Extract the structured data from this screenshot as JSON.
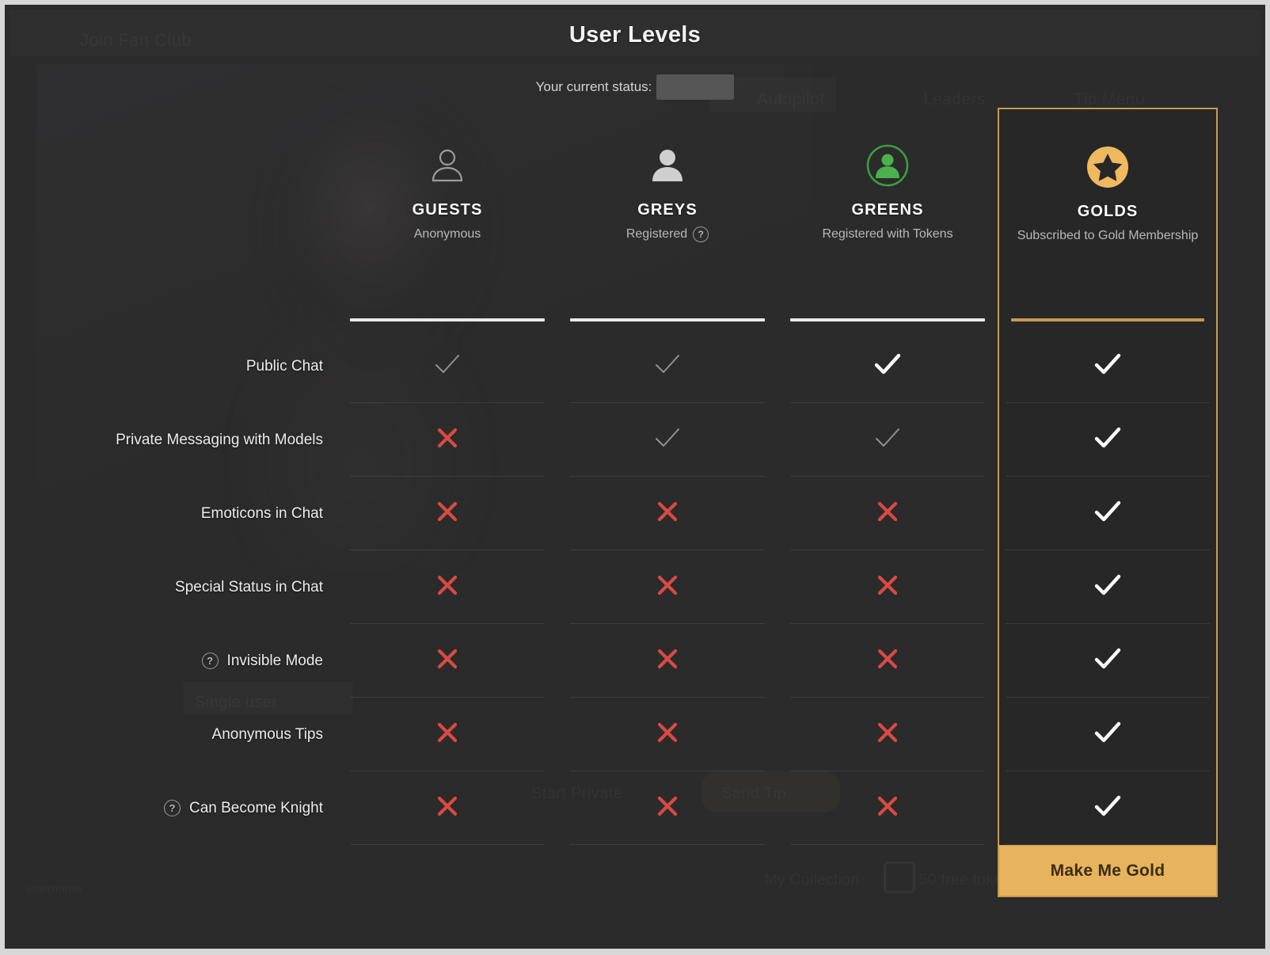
{
  "modal": {
    "title": "User Levels",
    "status_label": "Your current status:",
    "status_value_redacted": true
  },
  "theme": {
    "gold": "#e8b35e",
    "gold_border": "#c79b4e",
    "green": "#44a340",
    "cross_red": "#d94a43",
    "check_white": "#ffffff",
    "panel_bg": "#2b2b2b"
  },
  "columns": [
    {
      "id": "guests",
      "name": "GUESTS",
      "description": "Anonymous",
      "icon": "user-outline-icon",
      "has_help": false,
      "highlighted": false
    },
    {
      "id": "greys",
      "name": "GREYS",
      "description": "Registered",
      "icon": "user-filled-grey-icon",
      "has_help": true,
      "help_label": "?",
      "highlighted": false
    },
    {
      "id": "greens",
      "name": "GREENS",
      "description": "Registered with Tokens",
      "icon": "user-circle-green-icon",
      "has_help": false,
      "highlighted": false
    },
    {
      "id": "golds",
      "name": "GOLDS",
      "description": "Subscribed to Gold Membership",
      "icon": "star-circle-gold-icon",
      "has_help": false,
      "highlighted": true
    }
  ],
  "features": [
    {
      "label": "Public Chat",
      "help": false,
      "values": [
        "check-dim",
        "check-dim",
        "check-bold",
        "check-bold"
      ]
    },
    {
      "label": "Private Messaging with Models",
      "help": false,
      "values": [
        "cross",
        "check-dim",
        "check-dim",
        "check-bold"
      ]
    },
    {
      "label": "Emoticons in Chat",
      "help": false,
      "values": [
        "cross",
        "cross",
        "cross",
        "check-bold"
      ]
    },
    {
      "label": "Special Status in Chat",
      "help": false,
      "values": [
        "cross",
        "cross",
        "cross",
        "check-bold"
      ]
    },
    {
      "label": "Invisible Mode",
      "help": true,
      "help_label": "?",
      "values": [
        "cross",
        "cross",
        "cross",
        "check-bold"
      ]
    },
    {
      "label": "Anonymous Tips",
      "help": false,
      "values": [
        "cross",
        "cross",
        "cross",
        "check-bold"
      ]
    },
    {
      "label": "Can Become Knight",
      "help": true,
      "help_label": "?",
      "values": [
        "cross",
        "cross",
        "cross",
        "check-bold"
      ]
    }
  ],
  "cta": {
    "label": "Make Me Gold"
  },
  "glyphs": {
    "check": "✓",
    "cross": "✕",
    "help": "?"
  }
}
